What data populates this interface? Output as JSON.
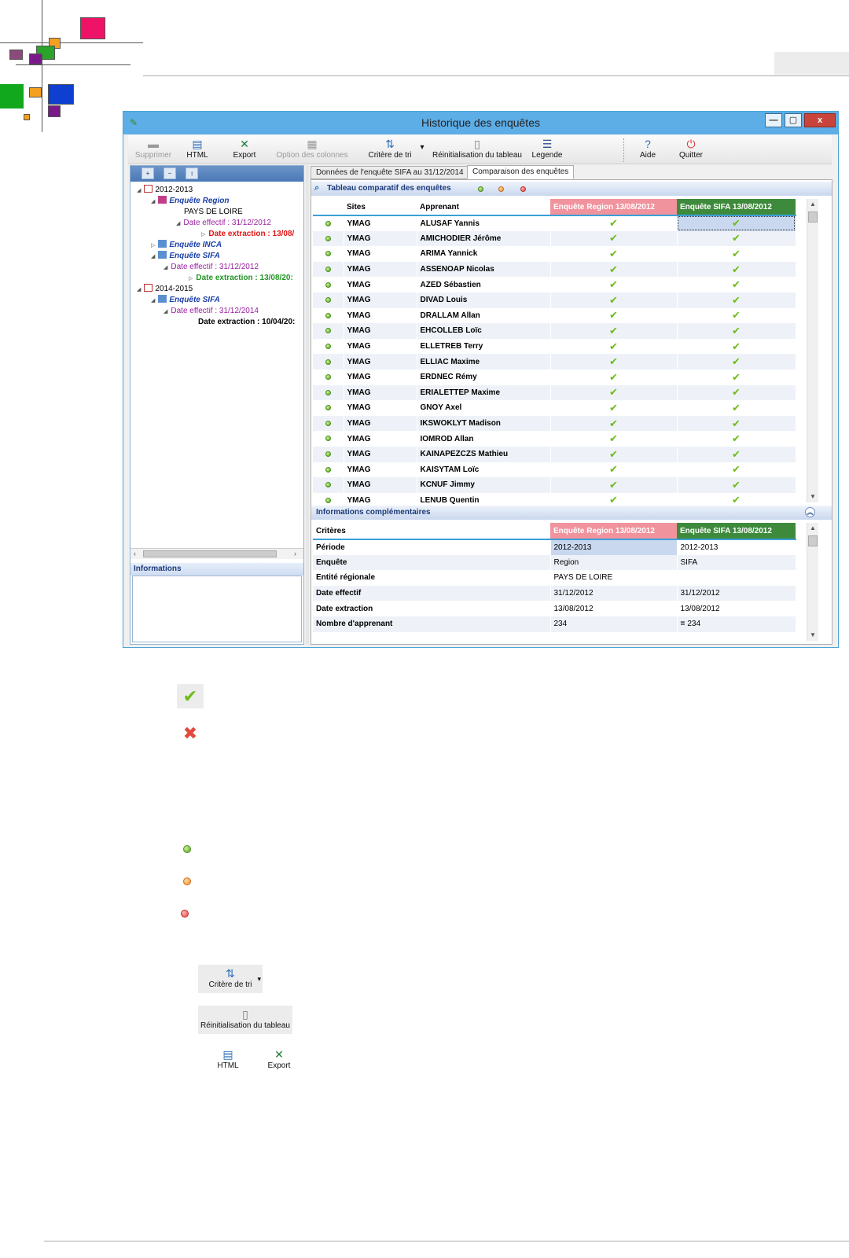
{
  "window": {
    "title": "Historique des enquêtes",
    "min_label": "—",
    "max_label": "▢",
    "close_label": "x"
  },
  "toolbar": {
    "supprimer": "Supprimer",
    "html": "HTML",
    "export": "Export",
    "option_colonnes": "Option des colonnes",
    "critere_tri": "Critère de tri",
    "reinit": "Réinitialisation du tableau",
    "legende": "Legende",
    "aide": "Aide",
    "quitter": "Quitter"
  },
  "tree": {
    "nodes": [
      {
        "label": "2012-2013"
      },
      {
        "label": "Enquête Region"
      },
      {
        "label": "PAYS DE LOIRE"
      },
      {
        "label": "Date effectif : 31/12/2012"
      },
      {
        "label": "Date extraction : 13/08/"
      },
      {
        "label": "Enquête INCA"
      },
      {
        "label": "Enquête SIFA"
      },
      {
        "label": "Date effectif : 31/12/2012"
      },
      {
        "label": "Date extraction : 13/08/20:"
      },
      {
        "label": "2014-2015"
      },
      {
        "label": "Enquête SIFA"
      },
      {
        "label": "Date effectif : 31/12/2014"
      },
      {
        "label": "Date extraction : 10/04/20:"
      }
    ]
  },
  "left_info": {
    "title": "Informations"
  },
  "tabs": [
    {
      "label": "Données de l'enquête SIFA au 31/12/2014"
    },
    {
      "label": "Comparaison des enquêtes"
    }
  ],
  "compare": {
    "title": "Tableau comparatif des enquêtes",
    "headers": {
      "sites": "Sites",
      "apprenant": "Apprenant",
      "col_region": "Enquête Region 13/08/2012",
      "col_sifa": "Enquête SIFA 13/08/2012"
    },
    "check_glyph": "✔",
    "rows": [
      {
        "site": "YMAG",
        "name": "ALUSAF Yannis"
      },
      {
        "site": "YMAG",
        "name": "AMICHODIER Jérôme"
      },
      {
        "site": "YMAG",
        "name": "ARIMA Yannick"
      },
      {
        "site": "YMAG",
        "name": "ASSENOAP Nicolas"
      },
      {
        "site": "YMAG",
        "name": "AZED Sébastien"
      },
      {
        "site": "YMAG",
        "name": "DIVAD Louis"
      },
      {
        "site": "YMAG",
        "name": "DRALLAM Allan"
      },
      {
        "site": "YMAG",
        "name": "EHCOLLEB Loïc"
      },
      {
        "site": "YMAG",
        "name": "ELLETREB Terry"
      },
      {
        "site": "YMAG",
        "name": "ELLIAC Maxime"
      },
      {
        "site": "YMAG",
        "name": "ERDNEC Rémy"
      },
      {
        "site": "YMAG",
        "name": "ERIALETTEP Maxime"
      },
      {
        "site": "YMAG",
        "name": "GNOY Axel"
      },
      {
        "site": "YMAG",
        "name": "IKSWOKLYT Madison"
      },
      {
        "site": "YMAG",
        "name": "IOMROD Allan"
      },
      {
        "site": "YMAG",
        "name": "KAINAPEZCZS Mathieu"
      },
      {
        "site": "YMAG",
        "name": "KAISYTAM Loïc"
      },
      {
        "site": "YMAG",
        "name": "KCNUF Jimmy"
      },
      {
        "site": "YMAG",
        "name": "LENUB Quentin"
      }
    ]
  },
  "complement": {
    "title": "Informations complémentaires",
    "headers": {
      "criteres": "Critères",
      "col_region": "Enquête Region 13/08/2012",
      "col_sifa": "Enquête SIFA 13/08/2012"
    },
    "rows": [
      {
        "label": "Période",
        "region": "2012-2013",
        "sifa": "2012-2013"
      },
      {
        "label": "Enquête",
        "region": "Region",
        "sifa": "SIFA"
      },
      {
        "label": "Entité régionale",
        "region": "PAYS DE LOIRE",
        "sifa": ""
      },
      {
        "label": "Date effectif",
        "region": "31/12/2012",
        "sifa": "31/12/2012"
      },
      {
        "label": "Date extraction",
        "region": "13/08/2012",
        "sifa": "13/08/2012"
      },
      {
        "label": "Nombre d'apprenant",
        "region": "234",
        "sifa": "234",
        "sifa_prefix": "="
      }
    ]
  },
  "legend": {
    "check": "✔",
    "cross": "✖",
    "critere_tri": "Critère de tri",
    "reinit": "Réinitialisation du tableau",
    "html": "HTML",
    "export": "Export"
  },
  "colors": {
    "accent": "#3aa0d8",
    "region_header": "#f0939d",
    "sifa_header": "#3e8a3c",
    "check": "#6bbd16"
  }
}
